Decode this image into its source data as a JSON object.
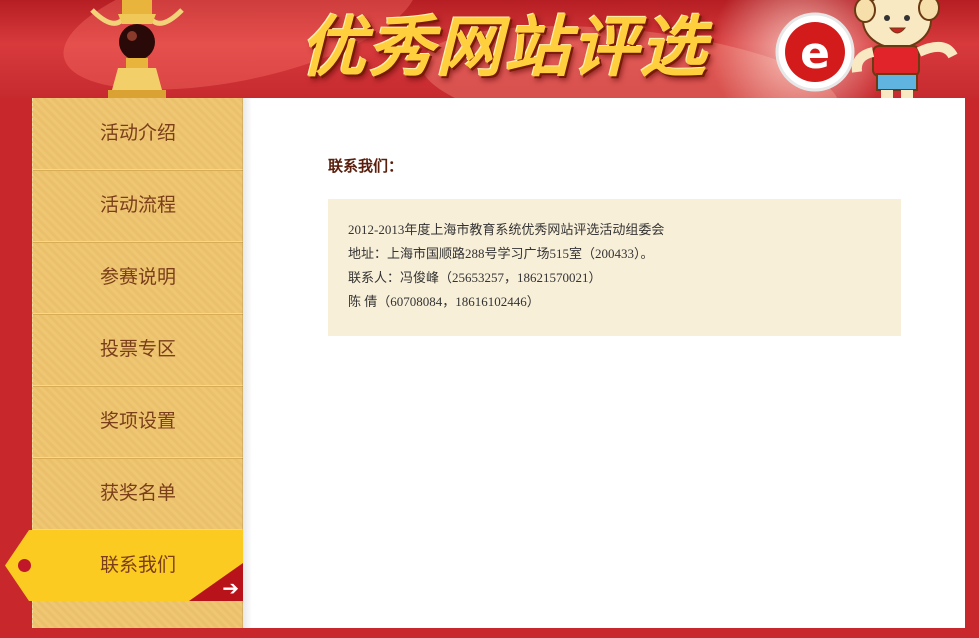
{
  "banner": {
    "title": "优秀网站评选",
    "logo_icon": "e-logo-icon",
    "mascot_icon": "cartoon-mascot-icon",
    "trophy_icon": "trophy-icon"
  },
  "colors": {
    "background_red": "#c8282c",
    "sidebar_gold": "#efc672",
    "active_yellow": "#fccb21",
    "info_box_bg": "#f8efd9",
    "nav_text": "#7a3e1a"
  },
  "sidebar": {
    "items": [
      {
        "label": "活动介绍"
      },
      {
        "label": "活动流程"
      },
      {
        "label": "参赛说明"
      },
      {
        "label": "投票专区"
      },
      {
        "label": "奖项设置"
      },
      {
        "label": "获奖名单"
      },
      {
        "label": "联系我们",
        "active": true
      }
    ],
    "active_arrow_icon": "arrow-right-icon"
  },
  "content": {
    "title": "联系我们：",
    "lines": [
      "2012-2013年度上海市教育系统优秀网站评选活动组委会",
      "地址：上海市国顺路288号学习广场515室（200433）。",
      "联系人：冯俊峰（25653257，18621570021）",
      "陈 倩（60708084，18616102446）"
    ]
  }
}
